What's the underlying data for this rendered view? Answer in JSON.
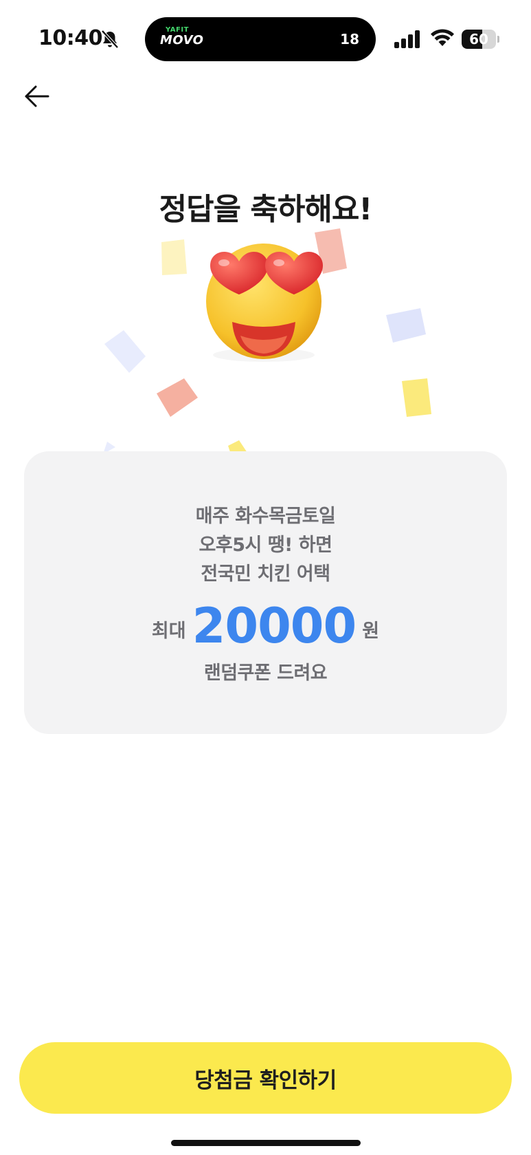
{
  "status_bar": {
    "time": "10:40",
    "island_brand_top": "YAFIT",
    "island_brand": "MOVO",
    "island_count": "18",
    "battery_level": 60,
    "battery_text": "60"
  },
  "nav": {
    "back_icon": "arrow-left-icon"
  },
  "title": "정답을 축하해요!",
  "illustration": {
    "icon": "heart-eyes-emoji-icon"
  },
  "card": {
    "line1": "매주 화수목금토일",
    "line2": "오후5시 땡! 하면",
    "line3": "전국민 치킨 어택",
    "amount_prefix": "최대",
    "amount_value": "20000",
    "amount_suffix": "원",
    "line5": "랜덤쿠폰 드려요"
  },
  "cta_label": "당첨금 확인하기",
  "colors": {
    "accent_blue": "#3d86ee",
    "button_yellow": "#fbe94e",
    "card_bg": "#f3f3f4"
  }
}
